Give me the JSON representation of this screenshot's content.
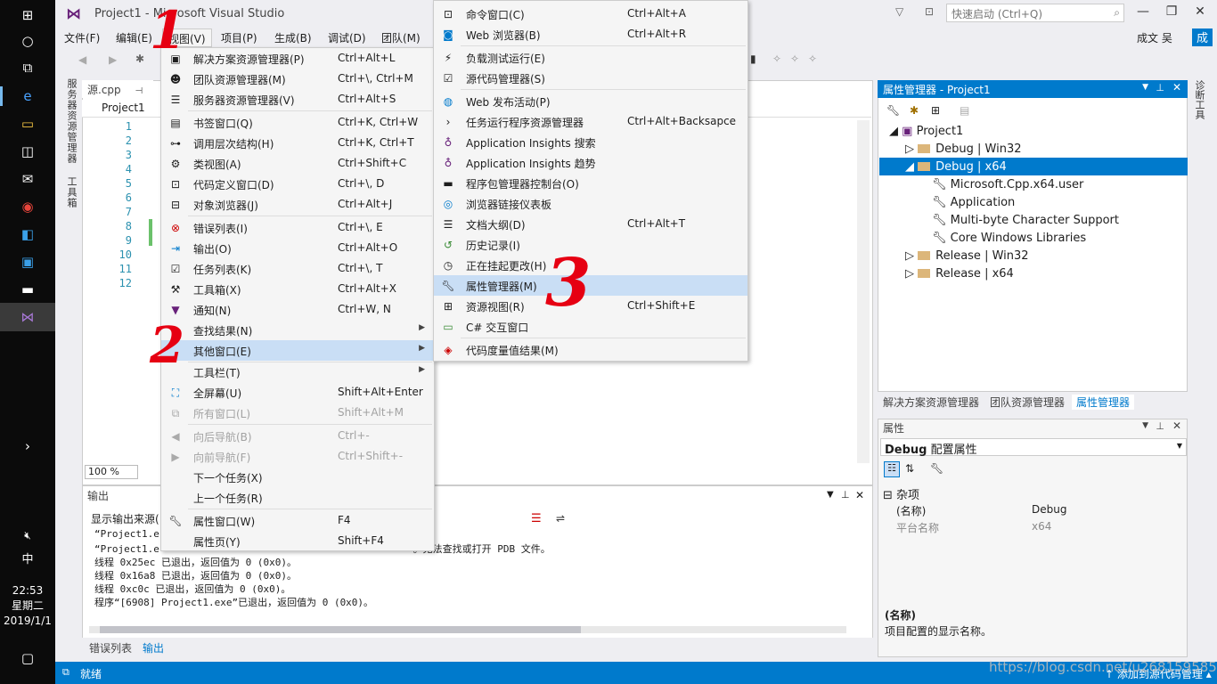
{
  "window": {
    "title": "Project1 - Microsoft Visual Studio"
  },
  "quick_launch": {
    "placeholder": "快速启动 (Ctrl+Q)"
  },
  "user": {
    "name": "成文 吴",
    "initial": "成"
  },
  "menubar": [
    "文件(F)",
    "编辑(E)",
    "视图(V)",
    "项目(P)",
    "生成(B)",
    "调试(D)",
    "团队(M)"
  ],
  "side_tabs": [
    "服务器资源管理器",
    "工具箱"
  ],
  "diag_tab": "诊断工具",
  "editor": {
    "tab": "源.cpp",
    "project": "Project1",
    "line_numbers": [
      "1",
      "2",
      "3",
      "4",
      "5",
      "6",
      "7",
      "8",
      "9",
      "10",
      "11",
      "12"
    ],
    "zoom": "100 %"
  },
  "output": {
    "title": "输出",
    "source_label": "显示输出来源(",
    "lines": [
      "“Project1.e",
      "“Project1.e                                          ”。无法查找或打开 PDB 文件。",
      "线程 0x25ec 已退出，返回值为 0 (0x0)。",
      "线程 0x16a8 已退出，返回值为 0 (0x0)。",
      "线程 0xc0c 已退出，返回值为 0 (0x0)。",
      "程序“[6908] Project1.exe”已退出，返回值为 0 (0x0)。"
    ],
    "tabs": [
      "错误列表",
      "输出"
    ]
  },
  "property_manager": {
    "title": "属性管理器 - Project1",
    "tree": {
      "root": "Project1",
      "debug_win32": "Debug | Win32",
      "debug_x64": "Debug | x64",
      "children": [
        "Microsoft.Cpp.x64.user",
        "Application",
        "Multi-byte Character Support",
        "Core Windows Libraries"
      ],
      "release_win32": "Release | Win32",
      "release_x64": "Release | x64"
    },
    "tabs": [
      "解决方案资源管理器",
      "团队资源管理器",
      "属性管理器"
    ]
  },
  "properties": {
    "title": "属性",
    "config_bold": "Debug",
    "config_rest": "配置属性",
    "category": "杂项",
    "rows": [
      {
        "name": "(名称)",
        "value": "Debug"
      },
      {
        "name": "平台名称",
        "value": "x64"
      }
    ],
    "desc_title": "(名称)",
    "desc_text": "项目配置的显示名称。"
  },
  "view_menu": [
    {
      "label": "解决方案资源管理器(P)",
      "shortcut": "Ctrl+Alt+L",
      "icon": "solution-explorer-icon"
    },
    {
      "label": "团队资源管理器(M)",
      "shortcut": "Ctrl+\\, Ctrl+M",
      "icon": "team-explorer-icon"
    },
    {
      "label": "服务器资源管理器(V)",
      "shortcut": "Ctrl+Alt+S",
      "icon": "server-explorer-icon"
    },
    {
      "label": "书签窗口(Q)",
      "shortcut": "Ctrl+K, Ctrl+W",
      "icon": "bookmark-icon"
    },
    {
      "label": "调用层次结构(H)",
      "shortcut": "Ctrl+K, Ctrl+T",
      "icon": "call-hierarchy-icon"
    },
    {
      "label": "类视图(A)",
      "shortcut": "Ctrl+Shift+C",
      "icon": "class-view-icon"
    },
    {
      "label": "代码定义窗口(D)",
      "shortcut": "Ctrl+\\, D",
      "icon": "code-definition-icon"
    },
    {
      "label": "对象浏览器(J)",
      "shortcut": "Ctrl+Alt+J",
      "icon": "object-browser-icon"
    },
    {
      "label": "错误列表(I)",
      "shortcut": "Ctrl+\\, E",
      "icon": "error-list-icon"
    },
    {
      "label": "输出(O)",
      "shortcut": "Ctrl+Alt+O",
      "icon": "output-icon"
    },
    {
      "label": "任务列表(K)",
      "shortcut": "Ctrl+\\, T",
      "icon": "task-list-icon"
    },
    {
      "label": "工具箱(X)",
      "shortcut": "Ctrl+Alt+X",
      "icon": "toolbox-icon"
    },
    {
      "label": "通知(N)",
      "shortcut": "Ctrl+W, N",
      "icon": "notification-icon"
    },
    {
      "label": "查找结果(N)",
      "shortcut": "",
      "icon": ""
    },
    {
      "label": "其他窗口(E)",
      "shortcut": "",
      "icon": ""
    },
    {
      "label": "工具栏(T)",
      "shortcut": "",
      "icon": ""
    },
    {
      "label": "全屏幕(U)",
      "shortcut": "Shift+Alt+Enter",
      "icon": "fullscreen-icon"
    },
    {
      "label": "所有窗口(L)",
      "shortcut": "Shift+Alt+M",
      "icon": "all-windows-icon"
    },
    {
      "label": "向后导航(B)",
      "shortcut": "Ctrl+-",
      "icon": "navigate-back-icon"
    },
    {
      "label": "向前导航(F)",
      "shortcut": "Ctrl+Shift+-",
      "icon": "navigate-forward-icon"
    },
    {
      "label": "下一个任务(X)",
      "shortcut": "",
      "icon": ""
    },
    {
      "label": "上一个任务(R)",
      "shortcut": "",
      "icon": ""
    },
    {
      "label": "属性窗口(W)",
      "shortcut": "F4",
      "icon": "properties-window-icon"
    },
    {
      "label": "属性页(Y)",
      "shortcut": "Shift+F4",
      "icon": ""
    }
  ],
  "other_windows_menu": [
    {
      "label": "命令窗口(C)",
      "shortcut": "Ctrl+Alt+A",
      "icon": "command-window-icon"
    },
    {
      "label": "Web 浏览器(B)",
      "shortcut": "Ctrl+Alt+R",
      "icon": "web-browser-icon"
    },
    {
      "label": "负载测试运行(E)",
      "shortcut": "",
      "icon": "load-test-icon"
    },
    {
      "label": "源代码管理器(S)",
      "shortcut": "",
      "icon": "source-control-icon"
    },
    {
      "label": "Web 发布活动(P)",
      "shortcut": "",
      "icon": "web-publish-icon"
    },
    {
      "label": "任务运行程序资源管理器",
      "shortcut": "Ctrl+Alt+Backsapce",
      "icon": "task-runner-icon"
    },
    {
      "label": "Application Insights 搜索",
      "shortcut": "",
      "icon": "app-insights-search-icon"
    },
    {
      "label": "Application Insights 趋势",
      "shortcut": "",
      "icon": "app-insights-trends-icon"
    },
    {
      "label": "程序包管理器控制台(O)",
      "shortcut": "",
      "icon": "package-console-icon"
    },
    {
      "label": "浏览器链接仪表板",
      "shortcut": "",
      "icon": "browser-link-icon"
    },
    {
      "label": "文档大纲(D)",
      "shortcut": "Ctrl+Alt+T",
      "icon": "document-outline-icon"
    },
    {
      "label": "历史记录(I)",
      "shortcut": "",
      "icon": "history-icon"
    },
    {
      "label": "正在挂起更改(H)",
      "shortcut": "",
      "icon": "pending-changes-icon"
    },
    {
      "label": "属性管理器(M)",
      "shortcut": "",
      "icon": "wrench-icon"
    },
    {
      "label": "资源视图(R)",
      "shortcut": "Ctrl+Shift+E",
      "icon": "resource-view-icon"
    },
    {
      "label": "C# 交互窗口",
      "shortcut": "",
      "icon": "csharp-interactive-icon"
    },
    {
      "label": "代码度量值结果(M)",
      "shortcut": "",
      "icon": "code-metrics-icon"
    }
  ],
  "status": {
    "ready": "就绪",
    "source_control": "添加到源代码管理"
  },
  "watermark": "https://blog.csdn.net/u2681595858",
  "taskbar": {
    "time": "22:53",
    "day": "星期二",
    "date": "2019/1/1",
    "ime": "中"
  },
  "annotations": [
    "1",
    "2",
    "3"
  ],
  "colors": {
    "accent": "#007acc",
    "highlight": "#c9def5",
    "annotation": "#e60012"
  }
}
